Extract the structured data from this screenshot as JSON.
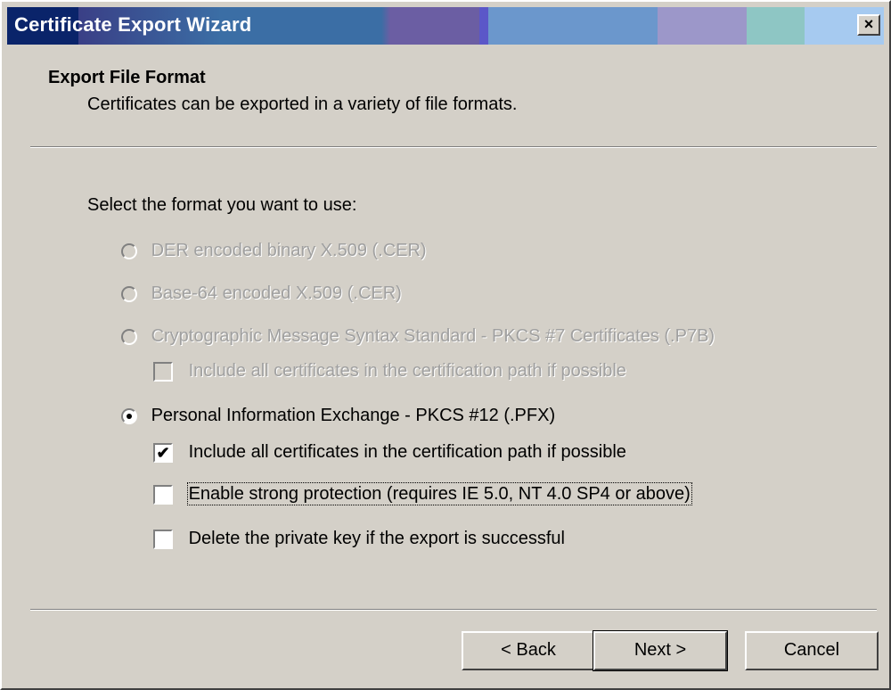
{
  "window": {
    "title": "Certificate Export Wizard",
    "close_glyph": "×"
  },
  "header": {
    "title": "Export File Format",
    "subtitle": "Certificates can be exported in a variety of file formats."
  },
  "body": {
    "prompt": "Select the format you want to use:"
  },
  "options": {
    "der": {
      "label": "DER encoded binary X.509 (.CER)",
      "enabled": false,
      "selected": false
    },
    "base64": {
      "label": "Base-64 encoded X.509 (.CER)",
      "enabled": false,
      "selected": false
    },
    "pkcs7": {
      "label": "Cryptographic Message Syntax Standard - PKCS #7 Certificates (.P7B)",
      "enabled": false,
      "selected": false
    },
    "pkcs7_include": {
      "label": "Include all certificates in the certification path if possible",
      "enabled": false,
      "checked": false
    },
    "pfx": {
      "label": "Personal Information Exchange - PKCS #12 (.PFX)",
      "enabled": true,
      "selected": true
    },
    "pfx_include": {
      "label": "Include all certificates in the certification path if possible",
      "enabled": true,
      "checked": true,
      "check_glyph": "✔"
    },
    "strong_protection": {
      "label": "Enable strong protection (requires IE 5.0, NT 4.0 SP4 or above)",
      "enabled": true,
      "checked": false
    },
    "delete_key": {
      "label": "Delete the private key if the export is successful",
      "enabled": true,
      "checked": false
    }
  },
  "buttons": {
    "back": "< Back",
    "next": "Next >",
    "cancel": "Cancel"
  },
  "colors": {
    "face": "#d4d0c8",
    "title_bar": "#0a246a",
    "disabled_text": "#a0a0a0"
  }
}
